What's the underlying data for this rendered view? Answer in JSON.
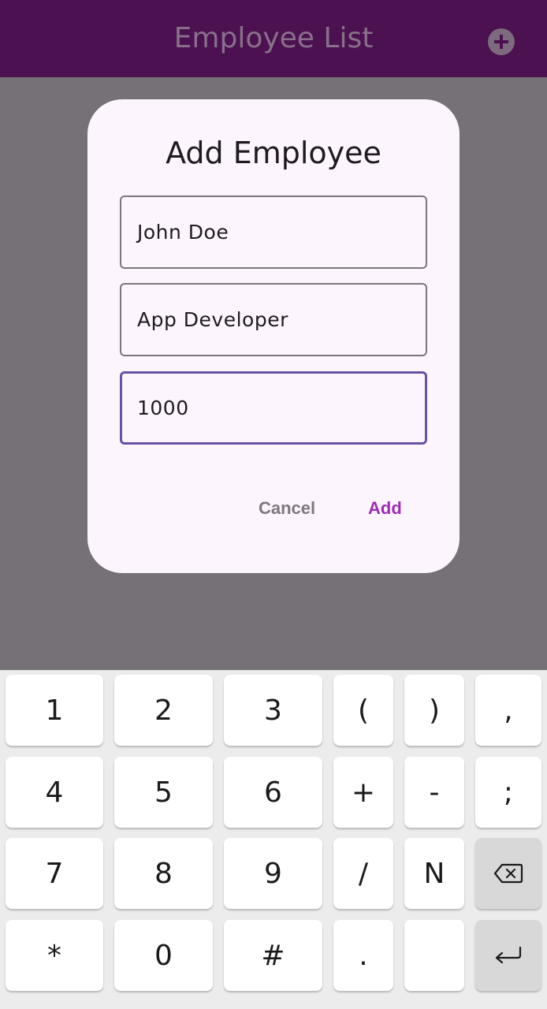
{
  "appbar": {
    "title": "Employee List",
    "action_icon": "add-circle-icon",
    "background": "#4b1150"
  },
  "dialog": {
    "title": "Add Employee",
    "fields": [
      {
        "value": "John Doe"
      },
      {
        "value": "App Developer"
      },
      {
        "value": "1000"
      }
    ],
    "buttons": {
      "cancel": "Cancel",
      "add": "Add"
    },
    "accent": "#9b2eb3"
  },
  "keyboard": {
    "rows": [
      [
        "1",
        "2",
        "3",
        "(",
        ")",
        ","
      ],
      [
        "4",
        "5",
        "6",
        "+",
        "-",
        ";"
      ],
      [
        "7",
        "8",
        "9",
        "/",
        "N",
        "backspace-icon"
      ],
      [
        "*",
        "0",
        "#",
        ".",
        "",
        "enter-icon"
      ]
    ]
  }
}
